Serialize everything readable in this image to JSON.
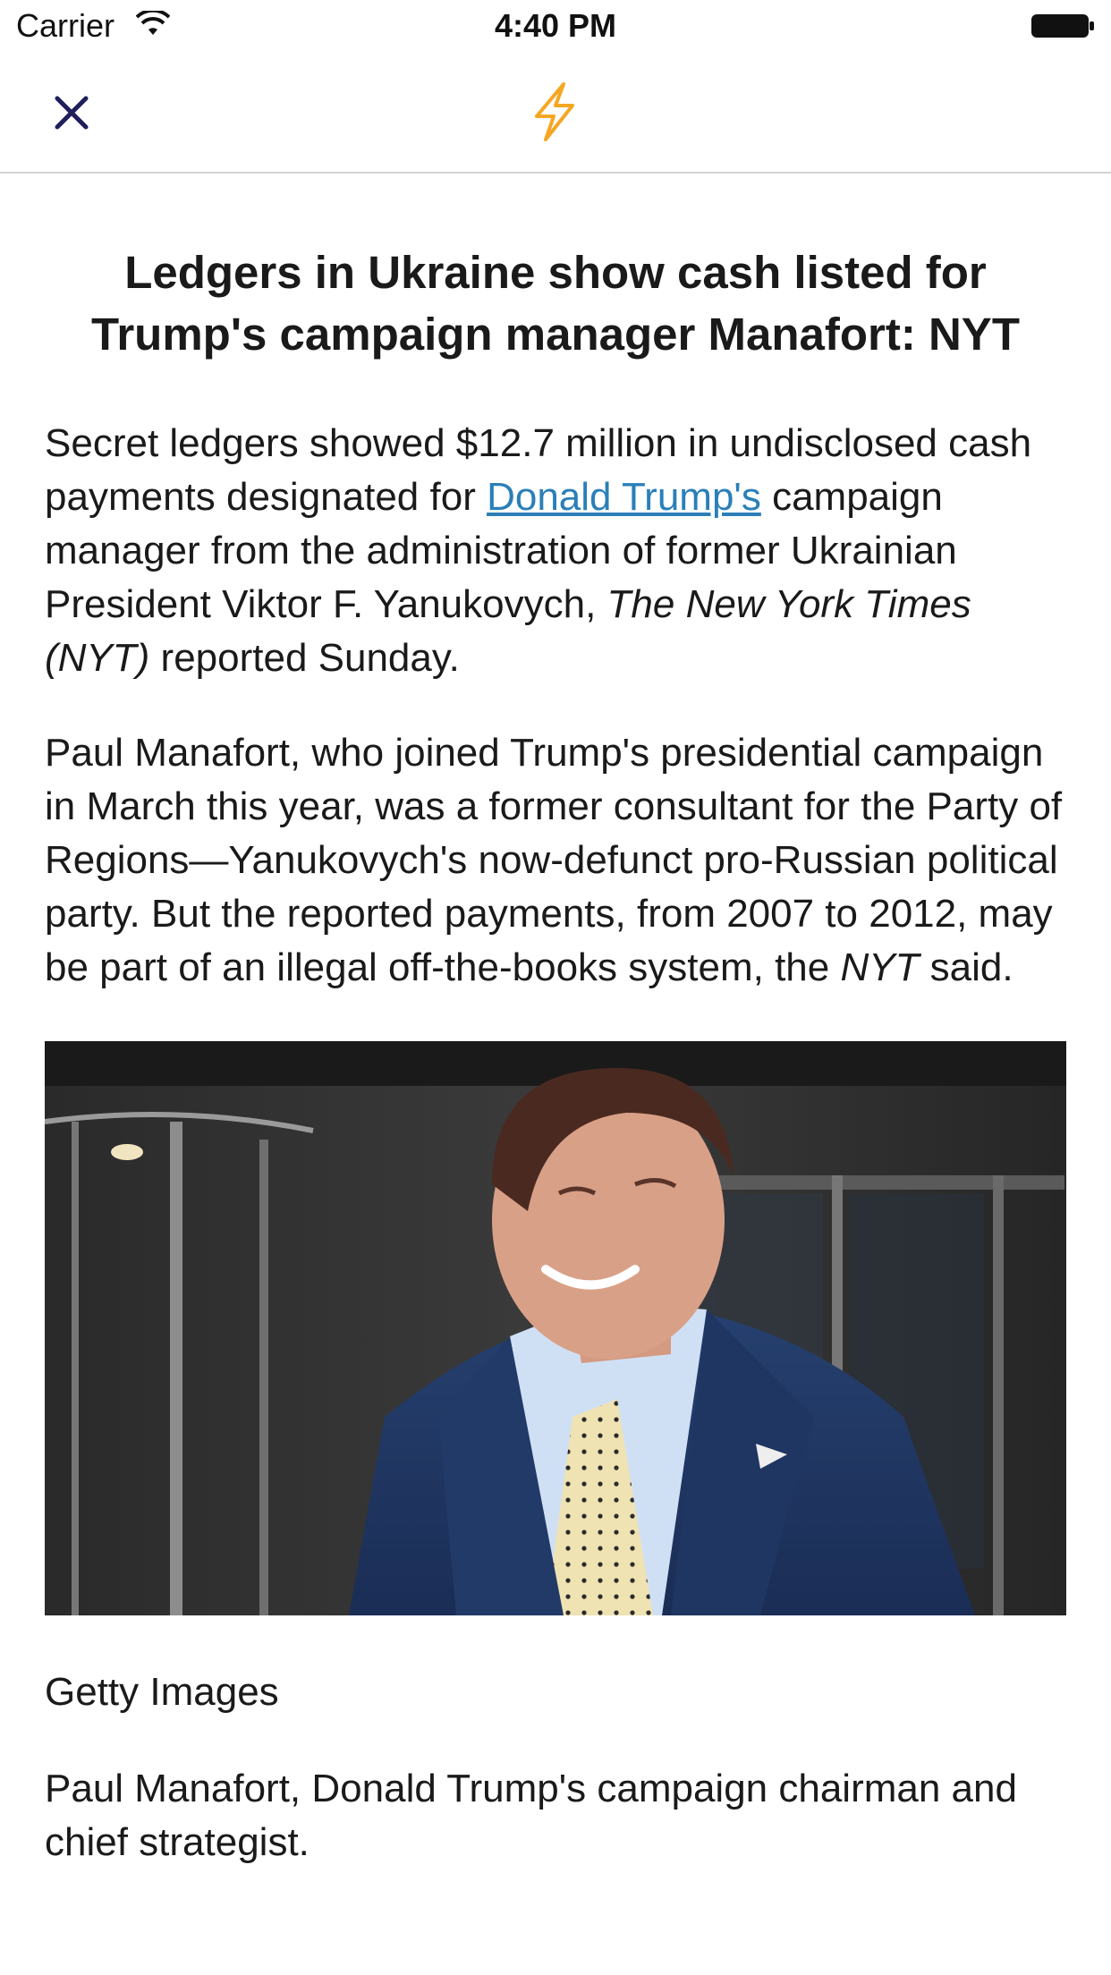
{
  "status_bar": {
    "carrier": "Carrier",
    "time": "4:40 PM",
    "icons": [
      "wifi-icon",
      "battery-icon"
    ]
  },
  "nav": {
    "close_icon": "close-icon",
    "center_icon": "lightning-bolt-icon",
    "accent_color": "#f5a623",
    "close_color": "#1f1f5c"
  },
  "article": {
    "headline": "Ledgers in Ukraine show cash listed for Trump's campaign manager Manafort: NYT",
    "p1": {
      "t1": "Secret ledgers showed $12.7 million in undisclosed cash payments designated for ",
      "link": "Donald Trump's",
      "t2": " campaign manager from the administration of former Ukrainian President Viktor F. Yanukovych, ",
      "em": "The New York Times (NYT)",
      "t3": " reported Sunday."
    },
    "p2": {
      "t1": "Paul Manafort, who joined Trump's presidential campaign in March this year, was a former consultant for the Party of Regions—Yanukovych's now-defunct pro-Russian political party. But the reported payments, from 2007 to 2012, may be part of an illegal off-the-books system, the ",
      "em": "NYT",
      "t2": " said."
    },
    "image_alt": "Photo of Paul Manafort smiling outside a building",
    "credit": "Getty Images",
    "caption": "Paul Manafort, Donald Trump's campaign chairman and chief strategist."
  }
}
